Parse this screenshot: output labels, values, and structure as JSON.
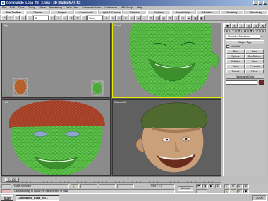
{
  "window": {
    "title": "Commando_Loba_Tst_2.max - 3D Studio MAX R3"
  },
  "menu": [
    "File",
    "Edit",
    "Tools",
    "Group",
    "Views",
    "Rendering",
    "Track View",
    "Schematic View",
    "Customize",
    "MAXScript",
    "Help"
  ],
  "tabs": [
    "Main Toolbar",
    "Objects",
    "Shapes",
    "Compounds",
    "Lights & Cameras",
    "Particles",
    "Helpers",
    "Space Warps",
    "Modifiers",
    "Modeling",
    "Rendering"
  ],
  "toolbar": {
    "selection_filter": "All",
    "view_mode": "View"
  },
  "viewports": [
    {
      "label": "Top"
    },
    {
      "label": "Front"
    },
    {
      "label": "Left"
    },
    {
      "label": "Camera01"
    }
  ],
  "command_panel": {
    "category": "Standard Primitives",
    "object_type_header": "Object Type",
    "autogrid": "AutoGrid",
    "buttons": [
      "Box",
      "Cone",
      "Sphere",
      "GeoSphere",
      "Cylinder",
      "Tube",
      "Torus",
      "Pyramid",
      "Teapot",
      "Plane"
    ],
    "name_color_header": "Name and Color",
    "object_color": "#8a1c1c"
  },
  "timeline": {
    "frame": "0 / 100"
  },
  "status": {
    "selection": "None Selected",
    "prompt": "Click and drag to adjust the camera field of view",
    "grid": "Grid = 1.0",
    "animate": "Animate"
  },
  "taskbar": {
    "start": "Start",
    "item": "Commando_Loba_Tst...",
    "clock": "20:00"
  }
}
